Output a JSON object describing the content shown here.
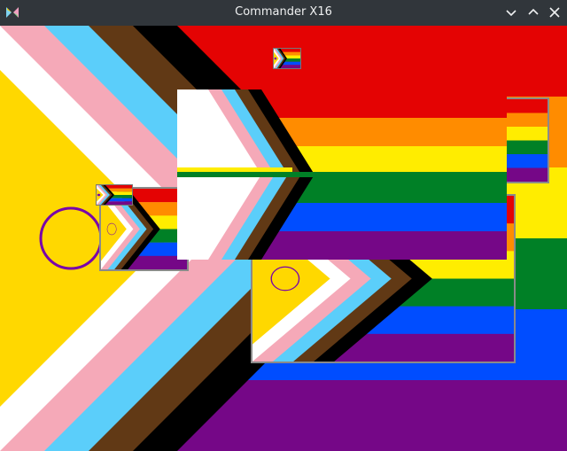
{
  "window": {
    "title": "Commander X16",
    "app_icon": "commander-x16-butterfly-icon",
    "buttons": [
      "minimize-icon",
      "maximize-icon",
      "close-icon"
    ]
  },
  "flag": {
    "name": "intersex-inclusive-progress-pride",
    "rainbow_colors": [
      "#e40303",
      "#ff8c00",
      "#ffed00",
      "#008026",
      "#004dff",
      "#750787"
    ],
    "chevron_colors": [
      "#ffffff",
      "#f5a9b8",
      "#5bcefa",
      "#613915",
      "#000000"
    ],
    "intersex_yellow": "#ffd800",
    "intersex_ring": "#7902aa"
  }
}
